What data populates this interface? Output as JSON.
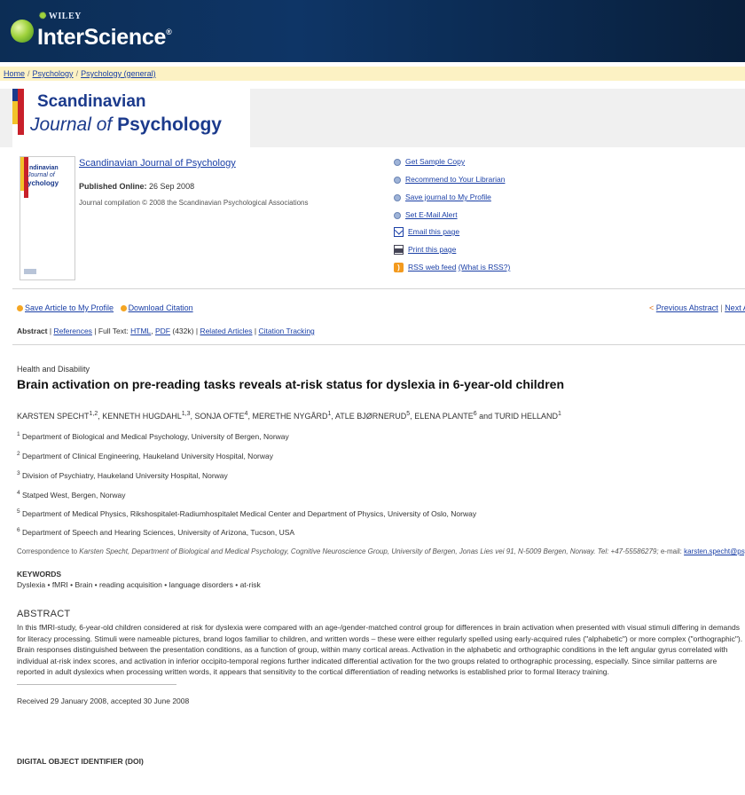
{
  "header": {
    "publisher": "WILEY",
    "brand": "InterScience",
    "brand_mark": "®"
  },
  "breadcrumb": {
    "items": [
      "Home",
      "Psychology",
      "Psychology (general)"
    ],
    "separator": "/"
  },
  "banner": {
    "line1": "Scandinavian",
    "line2_prefix": "Journal of",
    "line2_bold": "Psychology"
  },
  "journal": {
    "title": "Scandinavian Journal of Psychology",
    "published_label": "Published Online:",
    "published_date": "26 Sep 2008",
    "compilation": "Journal compilation © 2008 the Scandinavian Psychological Associations",
    "cover": {
      "l1": "ndinavian",
      "l2": "Journal of",
      "l3": "ychology"
    }
  },
  "tools": {
    "sample": "Get Sample Copy",
    "recommend": "Recommend to Your Librarian",
    "save_journal": "Save journal to My Profile",
    "alert": "Set E-Mail Alert",
    "email": "Email this page",
    "print": "Print this page",
    "rss": "RSS web feed",
    "rss_what": "(What is RSS?)"
  },
  "actions": {
    "save_article": "Save Article to My Profile",
    "download": "Download Citation",
    "prev": "Previous Abstract",
    "next": "Next Abstract",
    "prev_arrow": "<",
    "nav_sep": "|"
  },
  "tabs": {
    "abstract": "Abstract",
    "sep": "|",
    "references": "References",
    "fulltext": "Full Text:",
    "html": "HTML",
    "pdf": "PDF",
    "pdf_size": "(432k)",
    "related": "Related Articles",
    "tracking": "Citation Tracking"
  },
  "article": {
    "section": "Health and Disability",
    "title": "Brain activation on pre-reading tasks reveals at-risk status for dyslexia in 6-year-old children",
    "authors": [
      {
        "name": "KARSTEN SPECHT",
        "sup": "1,2",
        "sep": ", "
      },
      {
        "name": "KENNETH HUGDAHL",
        "sup": "1,3",
        "sep": ", "
      },
      {
        "name": "SONJA OFTE",
        "sup": "4",
        "sep": ", "
      },
      {
        "name": "MERETHE NYGÅRD",
        "sup": "1",
        "sep": ", "
      },
      {
        "name": "ATLE BJØRNERUD",
        "sup": "5",
        "sep": ", "
      },
      {
        "name": "ELENA PLANTE",
        "sup": "6",
        "sep": " and "
      },
      {
        "name": "TURID HELLAND",
        "sup": "1",
        "sep": ""
      }
    ],
    "affiliations": [
      {
        "num": "1",
        "text": "Department of Biological and Medical Psychology, University of Bergen, Norway"
      },
      {
        "num": "2",
        "text": "Department of Clinical Engineering, Haukeland University Hospital, Norway"
      },
      {
        "num": "3",
        "text": "Division of Psychiatry, Haukeland University Hospital, Norway"
      },
      {
        "num": "4",
        "text": "Statped West, Bergen, Norway"
      },
      {
        "num": "5",
        "text": "Department of Medical Physics, Rikshospitalet-Radiumhospitalet Medical Center and Department of Physics, University of Oslo, Norway"
      },
      {
        "num": "6",
        "text": "Department of Speech and Hearing Sciences, University of Arizona, Tucson, USA"
      }
    ],
    "correspondence_prefix": "Correspondence to",
    "correspondence_body": "Karsten Specht, Department of Biological and Medical Psychology, Cognitive Neuroscience Group, University of Bergen, Jonas Lies vei 91, N-5009 Bergen, Norway. Tel: +47-55586279;",
    "email_label": "e-mail:",
    "email": "karsten.specht@psybp.uib.no",
    "keywords_heading": "KEYWORDS",
    "keywords": "Dyslexia • fMRI • Brain • reading acquisition • language disorders • at-risk",
    "abstract_heading": "ABSTRACT",
    "abstract": "In this fMRI-study, 6-year-old children considered at risk for dyslexia were compared with an age-/gender-matched control group for differences in brain activation when presented with visual stimuli differing in demands for literacy processing. Stimuli were nameable pictures, brand logos familiar to children, and written words – these were either regularly spelled using early-acquired rules (\"alphabetic\") or more complex (\"orthographic\"). Brain responses distinguished between the presentation conditions, as a function of group, within many cortical areas. Activation in the alphabetic and orthographic conditions in the left angular gyrus correlated with individual at-risk index scores, and activation in inferior occipito-temporal regions further indicated differential activation for the two groups related to orthographic processing, especially. Since similar patterns are reported in adult dyslexics when processing written words, it appears that sensitivity to the cortical differentiation of reading networks is established prior to formal literacy training.",
    "received": "Received 29 January 2008, accepted 30 June 2008",
    "doi_heading": "DIGITAL OBJECT IDENTIFIER (DOI)"
  },
  "colors": {
    "header_bg": "#0e3566",
    "breadcrumb_bg": "#fcf2c4",
    "link": "#1a3fa6",
    "accent_green": "#9fd23c",
    "accent_orange": "#f5a623"
  }
}
